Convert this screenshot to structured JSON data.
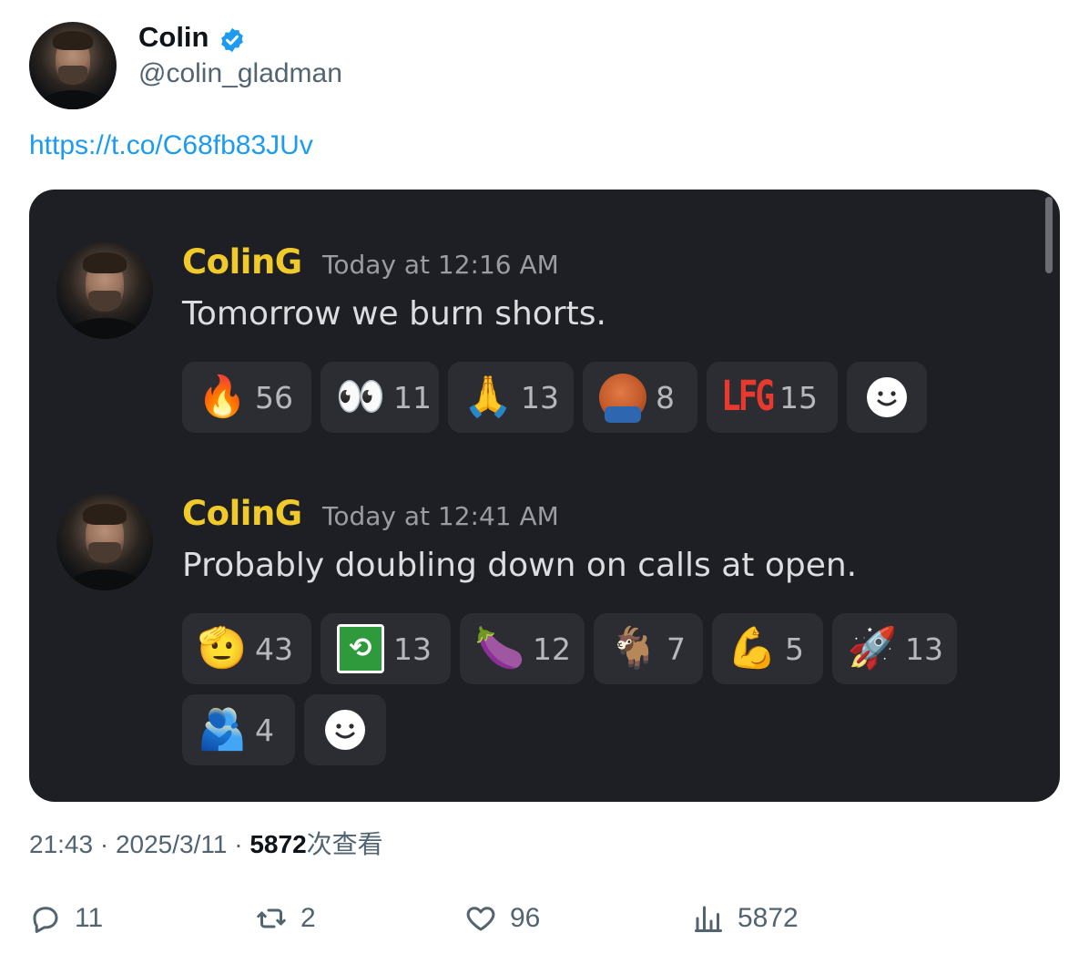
{
  "tweet": {
    "author_name": "Colin",
    "author_handle": "@colin_gladman",
    "link_text": "https://t.co/C68fb83JUv",
    "time": "21:43",
    "separator": "·",
    "date": "2025/3/11",
    "views_count": "5872",
    "views_label": "次查看"
  },
  "chat": {
    "messages": [
      {
        "author": "ColinG",
        "time": "Today at 12:16 AM",
        "text": "Tomorrow we burn shorts.",
        "reactions": [
          {
            "emoji": "🔥",
            "icon": "fire-emoji",
            "count": "56"
          },
          {
            "emoji": "👀",
            "icon": "eyes-emoji",
            "count": "11"
          },
          {
            "emoji": "🙏",
            "icon": "folded-hands-emoji",
            "count": "13"
          },
          {
            "emoji": "",
            "icon": "pepe-emoji",
            "count": "8"
          },
          {
            "emoji": "LFG",
            "icon": "lfg-emoji",
            "count": "15"
          }
        ]
      },
      {
        "author": "ColinG",
        "time": "Today at 12:41 AM",
        "text": "Probably doubling down on calls at open.",
        "reactions": [
          {
            "emoji": "🫡",
            "icon": "saluting-face-emoji",
            "count": "43"
          },
          {
            "emoji": "⟲",
            "icon": "uno-reverse-emoji",
            "count": "13"
          },
          {
            "emoji": "🍆",
            "icon": "eggplant-emoji",
            "count": "12"
          },
          {
            "emoji": "🐐",
            "icon": "goat-emoji",
            "count": "7"
          },
          {
            "emoji": "💪",
            "icon": "flexed-biceps-emoji",
            "count": "5"
          },
          {
            "emoji": "🚀",
            "icon": "rocket-emoji",
            "count": "13"
          },
          {
            "emoji": "🫂",
            "icon": "people-hugging-emoji",
            "count": "4"
          }
        ]
      }
    ]
  },
  "actions": {
    "replies": "11",
    "retweets": "2",
    "likes": "96",
    "views": "5872"
  },
  "colors": {
    "link": "#1d9bf0",
    "verified": "#1d9bf0",
    "chat_bg": "#1e1f24",
    "username": "#f0c92a",
    "muted": "#536471"
  }
}
